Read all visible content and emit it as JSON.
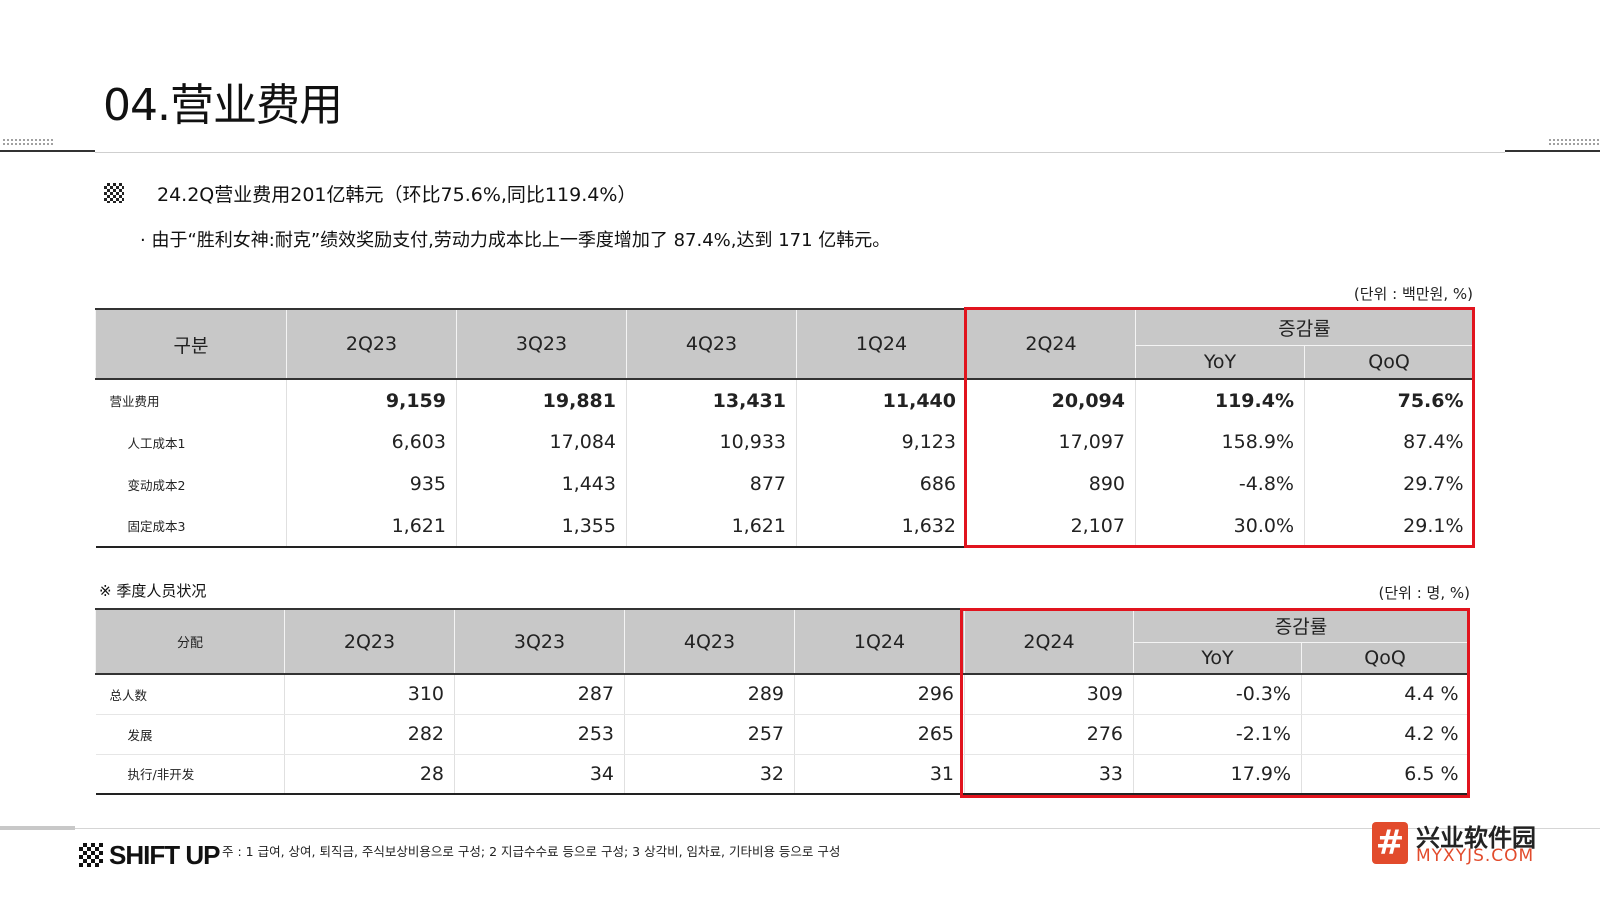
{
  "page": {
    "title": "04.营业费用",
    "headline": "24.2Q营业费用201亿韩元（环比75.6%,同比119.4%）",
    "bullet": "· 由于“胜利女神:耐克”绩效奖励支付,劳动力成本比上一季度增加了 87.4%,达到 171 亿韩元。"
  },
  "table1": {
    "unit": "(단위 : 백만원, %)",
    "headers": {
      "label": "구분",
      "q1": "2Q23",
      "q2": "3Q23",
      "q3": "4Q23",
      "q4": "1Q24",
      "q5": "2Q24",
      "change": "증감률",
      "yoy": "YoY",
      "qoq": "QoQ"
    },
    "rows": [
      {
        "label": "营业费用",
        "v": [
          "9,159",
          "19,881",
          "13,431",
          "11,440",
          "20,094",
          "119.4%",
          "75.6%"
        ]
      },
      {
        "label": "人工成本1",
        "v": [
          "6,603",
          "17,084",
          "10,933",
          "9,123",
          "17,097",
          "158.9%",
          "87.4%"
        ]
      },
      {
        "label": "变动成本2",
        "v": [
          "935",
          "1,443",
          "877",
          "686",
          "890",
          "-4.8%",
          "29.7%"
        ]
      },
      {
        "label": "固定成本3",
        "v": [
          "1,621",
          "1,355",
          "1,621",
          "1,632",
          "2,107",
          "30.0%",
          "29.1%"
        ]
      }
    ]
  },
  "table2": {
    "section_title": "※ 季度人员状况",
    "unit": "(단위 : 명, %)",
    "headers": {
      "label": "分配",
      "q1": "2Q23",
      "q2": "3Q23",
      "q3": "4Q23",
      "q4": "1Q24",
      "q5": "2Q24",
      "change": "증감률",
      "yoy": "YoY",
      "qoq": "QoQ"
    },
    "rows": [
      {
        "label": "总人数",
        "v": [
          "310",
          "287",
          "289",
          "296",
          "309",
          "-0.3%",
          "4.4 %"
        ]
      },
      {
        "label": "发展",
        "v": [
          "282",
          "253",
          "257",
          "265",
          "276",
          "-2.1%",
          "4.2 %"
        ]
      },
      {
        "label": "执行/非开发",
        "v": [
          "28",
          "34",
          "32",
          "31",
          "33",
          "17.9%",
          "6.5 %"
        ]
      }
    ]
  },
  "footer": {
    "logo": "SHIFT UP",
    "note": "주 : 1 급여, 상여, 퇴직금, 주식보상비용으로 구성; 2 지급수수료 등으로 구성; 3 상각비, 임차료, 기타비용 등으로 구성"
  },
  "watermark": {
    "icon_glyph": "#",
    "cn": "兴业软件园",
    "en": "MYXYJS.COM",
    "color": "#e24b2c"
  },
  "colors": {
    "highlight_border": "#e1141e",
    "header_bg": "#c8c8c8"
  }
}
